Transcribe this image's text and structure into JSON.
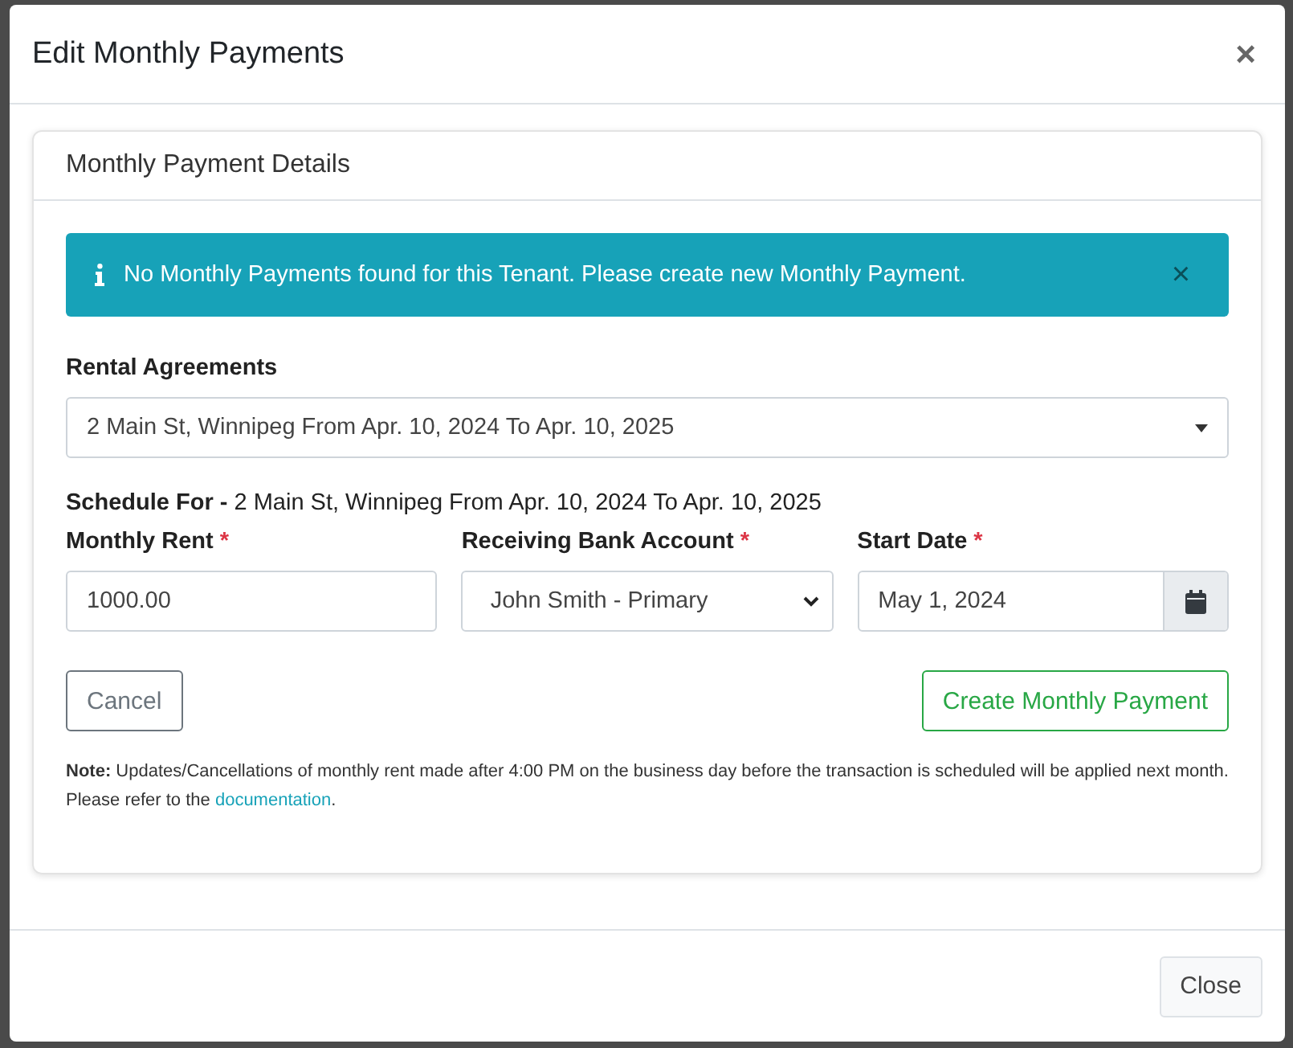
{
  "modal": {
    "title": "Edit Monthly Payments",
    "close_glyph": "×"
  },
  "card": {
    "title": "Monthly Payment Details"
  },
  "alert": {
    "text": "No Monthly Payments found for this Tenant. Please create new Monthly Payment.",
    "dismiss_glyph": "×"
  },
  "rental_agreements": {
    "label": "Rental Agreements",
    "value": "2 Main St, Winnipeg From Apr. 10, 2024 To Apr. 10, 2025"
  },
  "schedule_for": "**Schedule For -** 2 Main St, Winnipeg From Apr. 10, 2024 To Apr. 10, 2025",
  "fields": [
    {
      "kind": "text",
      "label": "Monthly Rent",
      "required_mark": "*",
      "value": "1000.00"
    },
    {
      "kind": "select",
      "label": "Receiving Bank Account",
      "required_mark": "*",
      "value": "John Smith - Primary"
    },
    {
      "kind": "date",
      "label": "Start Date",
      "required_mark": "*",
      "value": "May 1, 2024"
    }
  ],
  "buttons": {
    "cancel": "Cancel",
    "create": "Create Monthly Payment"
  },
  "note": {
    "text": "**Note:** Updates/Cancellations of monthly rent made after 4:00 PM on the business day before the transaction is scheduled will be applied next month. Please refer to the ",
    "link": "documentation",
    "after": "."
  },
  "footer": {
    "close": "Close"
  }
}
